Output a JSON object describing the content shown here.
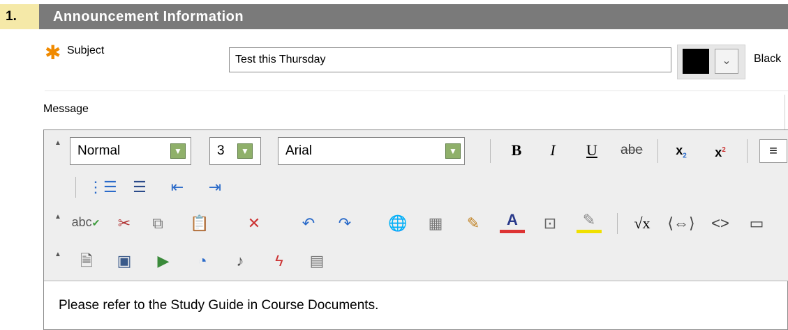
{
  "section": {
    "number": "1.",
    "title": "Announcement Information"
  },
  "subject": {
    "label": "Subject",
    "value": "Test this Thursday"
  },
  "color": {
    "name": "Black",
    "swatch": "#000000"
  },
  "message": {
    "label": "Message",
    "body": "Please refer to the Study Guide in Course Documents."
  },
  "toolbar": {
    "format_value": "Normal",
    "size_value": "3",
    "font_value": "Arial",
    "bold": "B",
    "italic": "I",
    "underline": "U",
    "strike": "abe",
    "spell": "abc"
  },
  "colors": {
    "required": "#f08a00",
    "header": "#7a7a7a",
    "step": "#f5e9a8",
    "dropdown": "#8fb06a"
  }
}
